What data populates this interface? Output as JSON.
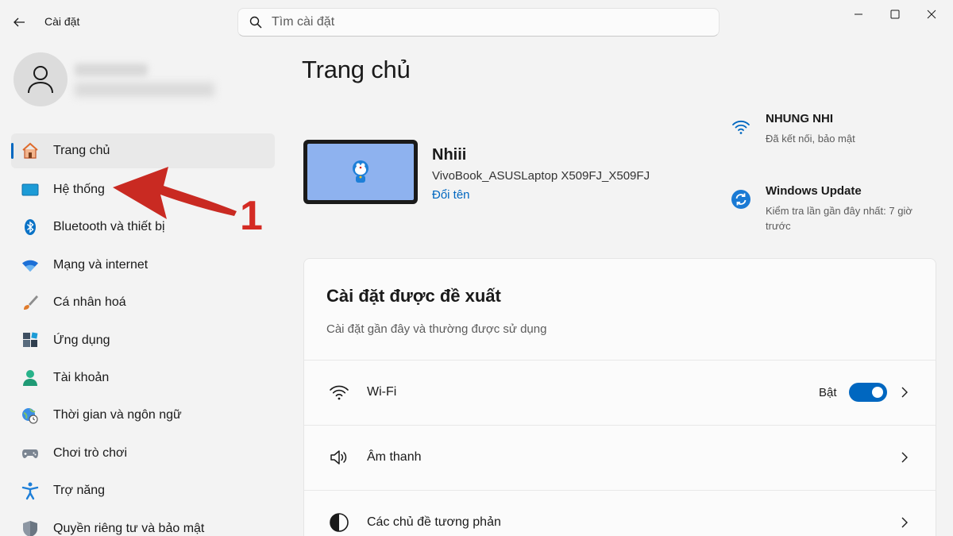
{
  "window": {
    "app_title": "Cài đặt",
    "search_placeholder": "Tìm cài đặt"
  },
  "sidebar": {
    "items": [
      {
        "label": "Trang chủ",
        "icon": "home-icon",
        "active": true
      },
      {
        "label": "Hệ thống",
        "icon": "system-icon"
      },
      {
        "label": "Bluetooth và thiết bị",
        "icon": "bluetooth-icon"
      },
      {
        "label": "Mạng và internet",
        "icon": "wifi-icon"
      },
      {
        "label": "Cá nhân hoá",
        "icon": "brush-icon"
      },
      {
        "label": "Ứng dụng",
        "icon": "apps-icon"
      },
      {
        "label": "Tài khoản",
        "icon": "account-icon"
      },
      {
        "label": "Thời gian và ngôn ngữ",
        "icon": "globe-clock-icon"
      },
      {
        "label": "Chơi trò chơi",
        "icon": "gamepad-icon"
      },
      {
        "label": "Trợ năng",
        "icon": "accessibility-icon"
      },
      {
        "label": "Quyền riêng tư và bảo mật",
        "icon": "shield-icon"
      }
    ]
  },
  "annotation": {
    "number": "1",
    "color": "#d42b24"
  },
  "main": {
    "page_title": "Trang chủ",
    "device": {
      "name": "Nhiii",
      "model": "VivoBook_ASUSLaptop X509FJ_X509FJ",
      "rename_link": "Đổi tên"
    },
    "status": {
      "network_title": "NHUNG NHI",
      "network_sub": "Đã kết nối, bảo mật",
      "update_title": "Windows Update",
      "update_sub": "Kiểm tra lần gần đây nhất: 7 giờ trước"
    },
    "recommended": {
      "title": "Cài đặt được đề xuất",
      "subtitle": "Cài đặt gần đây và thường được sử dụng",
      "rows": [
        {
          "label": "Wi-Fi",
          "icon": "wifi-icon",
          "toggle_label": "Bật",
          "toggle_on": true
        },
        {
          "label": "Âm thanh",
          "icon": "speaker-icon"
        },
        {
          "label": "Các chủ đề tương phản",
          "icon": "contrast-icon"
        }
      ]
    }
  },
  "colors": {
    "accent": "#0067c0",
    "background": "#f3f3f3"
  }
}
